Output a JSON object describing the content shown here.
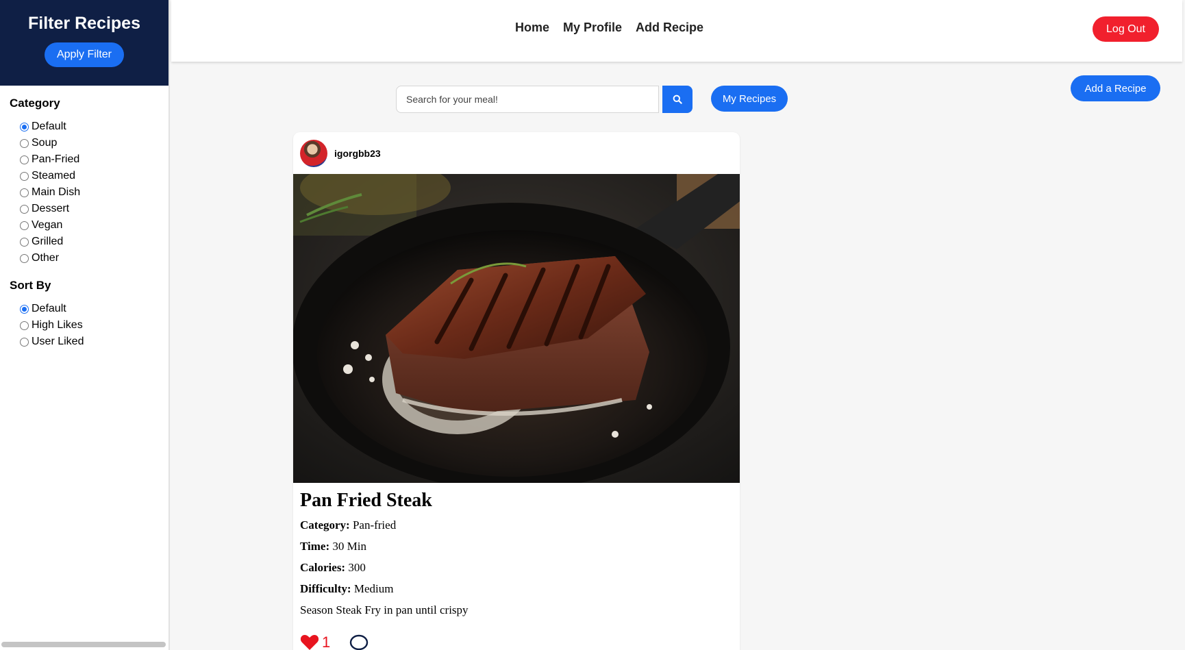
{
  "sidebar": {
    "title": "Filter Recipes",
    "apply_label": "Apply Filter",
    "category_heading": "Category",
    "categories": [
      "Default",
      "Soup",
      "Pan-Fried",
      "Steamed",
      "Main Dish",
      "Dessert",
      "Vegan",
      "Grilled",
      "Other"
    ],
    "category_selected": "Default",
    "sort_heading": "Sort By",
    "sort_options": [
      "Default",
      "High Likes",
      "User Liked"
    ],
    "sort_selected": "Default"
  },
  "nav": {
    "links": [
      "Home",
      "My Profile",
      "Add Recipe"
    ],
    "logout_label": "Log Out"
  },
  "search": {
    "placeholder": "Search for your meal!",
    "value": ""
  },
  "buttons": {
    "my_recipes": "My Recipes",
    "add_recipe": "Add a Recipe"
  },
  "post": {
    "username": "igorgbb23",
    "title": "Pan Fried Steak",
    "fields": [
      {
        "label": "Category:",
        "value": "Pan-fried"
      },
      {
        "label": "Time:",
        "value": "30 Min"
      },
      {
        "label": "Calories:",
        "value": "300"
      },
      {
        "label": "Difficulty:",
        "value": "Medium"
      }
    ],
    "description": "Season Steak Fry in pan until crispy",
    "likes": "1"
  },
  "colors": {
    "sidebar_header": "#0f1f45",
    "primary": "#1a6ef2",
    "danger": "#f1202d",
    "like": "#e8141f"
  }
}
